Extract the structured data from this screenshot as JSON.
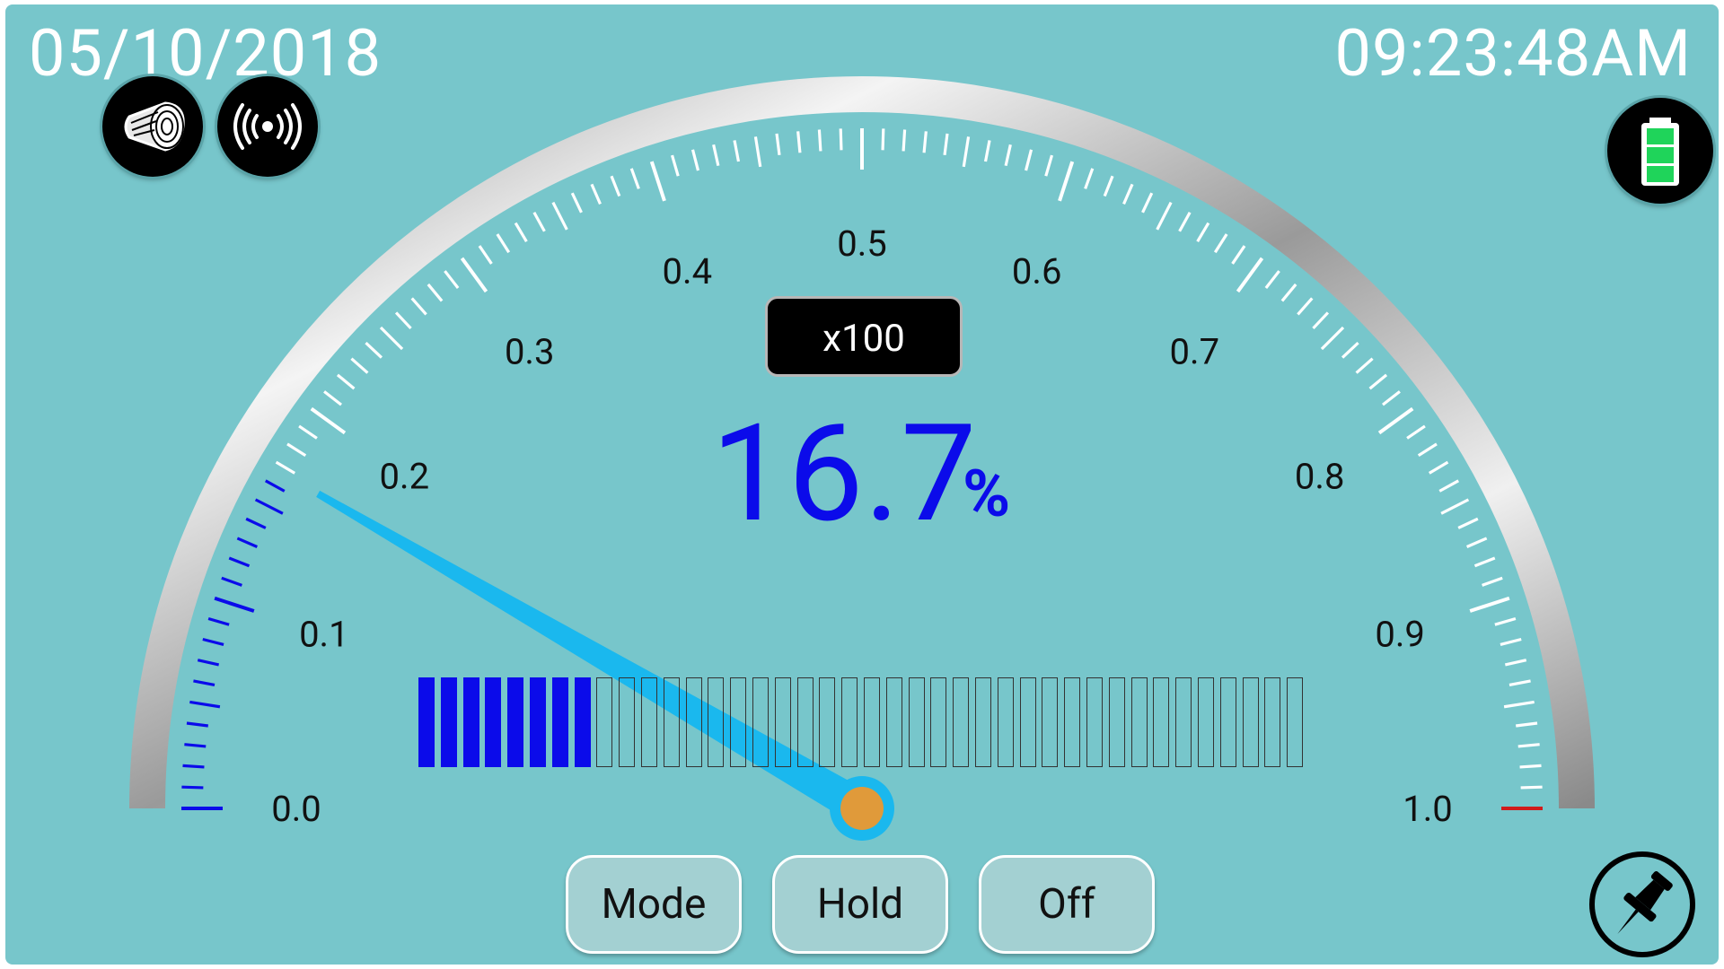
{
  "header": {
    "date": "05/10/2018",
    "time": "09:23:48AM"
  },
  "status_icons": {
    "left": [
      "wood-log-icon",
      "wireless-signal-icon"
    ],
    "right": [
      "battery-full-icon"
    ]
  },
  "gauge": {
    "multiplier_label": "x100",
    "scale_labels": [
      "0.0",
      "0.1",
      "0.2",
      "0.3",
      "0.4",
      "0.5",
      "0.6",
      "0.7",
      "0.8",
      "0.9",
      "1.0"
    ],
    "value_fraction": 0.167,
    "reading": "16.7",
    "unit": "%",
    "colors": {
      "active_ticks": "#0b0bea",
      "inactive_ticks": "#ffffff",
      "needle": "#1ab8ee",
      "end_tick": "#d21b1b",
      "pivot": "#e09a3a"
    }
  },
  "level_bar": {
    "total_segments": 40,
    "filled_segments": 8
  },
  "buttons": {
    "mode": "Mode",
    "hold": "Hold",
    "off": "Off"
  },
  "pin_button": {
    "icon": "pushpin-icon"
  }
}
